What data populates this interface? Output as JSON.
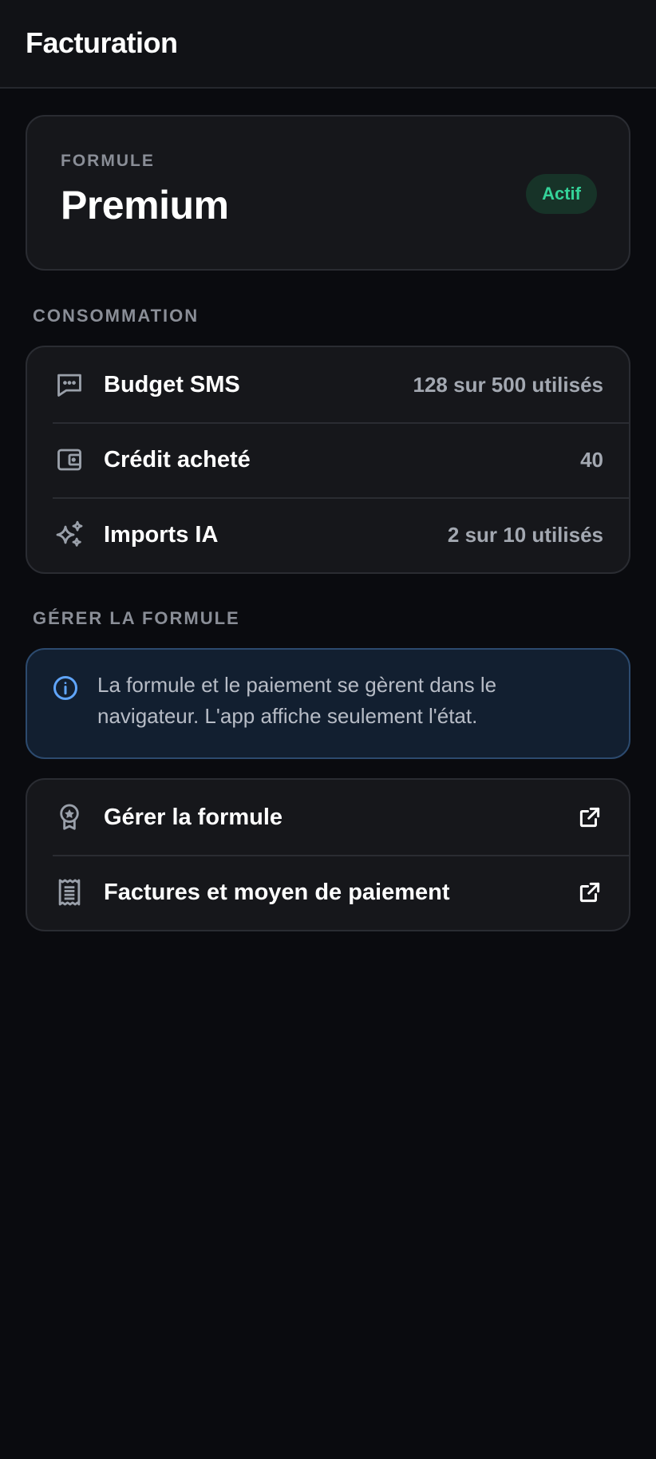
{
  "header": {
    "title": "Facturation"
  },
  "plan": {
    "label": "FORMULE",
    "name": "Premium",
    "status": "Actif",
    "status_color": "#34d399"
  },
  "consumption": {
    "section_label": "CONSOMMATION",
    "items": [
      {
        "icon": "message-dots-icon",
        "label": "Budget SMS",
        "value": "128 sur 500 utilisés"
      },
      {
        "icon": "wallet-icon",
        "label": "Crédit acheté",
        "value": "40"
      },
      {
        "icon": "sparkles-icon",
        "label": "Imports IA",
        "value": "2 sur 10 utilisés"
      }
    ]
  },
  "manage": {
    "section_label": "GÉRER LA FORMULE",
    "info_text": "La formule et le paiement se gèrent dans le navigateur. L'app affiche seulement l'état.",
    "info_color": "#60a5fa",
    "links": [
      {
        "icon": "award-icon",
        "label": "Gérer la formule",
        "action_icon": "external-link-icon"
      },
      {
        "icon": "receipt-icon",
        "label": "Factures et moyen de paiement",
        "action_icon": "external-link-icon"
      }
    ]
  }
}
